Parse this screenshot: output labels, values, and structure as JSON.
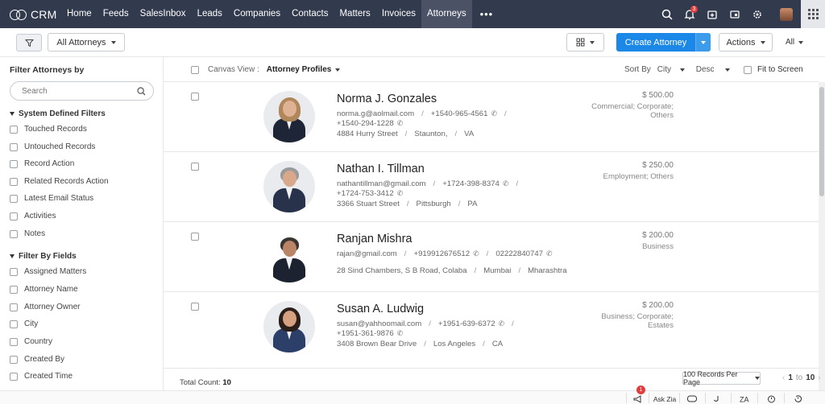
{
  "brand": {
    "name": "CRM",
    "icon": "crm-logo-icon"
  },
  "nav": {
    "items": [
      "Home",
      "Feeds",
      "SalesInbox",
      "Leads",
      "Companies",
      "Contacts",
      "Matters",
      "Invoices",
      "Attorneys"
    ],
    "active": "Attorneys",
    "more": "•••",
    "notification_count": "3"
  },
  "toolbar": {
    "view_filter": "All Attorneys",
    "create_label": "Create Attorney",
    "actions_label": "Actions",
    "all_label": "All"
  },
  "sidebar": {
    "title": "Filter Attorneys by",
    "search_placeholder": "Search",
    "system_section": "System Defined Filters",
    "system_filters": [
      "Touched Records",
      "Untouched Records",
      "Record Action",
      "Related Records Action",
      "Latest Email Status",
      "Activities",
      "Notes"
    ],
    "fields_section": "Filter By Fields",
    "field_filters": [
      "Assigned Matters",
      "Attorney Name",
      "Attorney Owner",
      "City",
      "Country",
      "Created By",
      "Created Time"
    ]
  },
  "canvas": {
    "label": "Canvas View :",
    "value": "Attorney Profiles",
    "sort_label": "Sort By",
    "sort_field": "City",
    "sort_order": "Desc",
    "fit_label": "Fit to Screen"
  },
  "records": [
    {
      "name": "Norma J. Gonzales",
      "line1": [
        "norma.g@aolmail.com",
        "+1540-965-4561"
      ],
      "line2": [
        "+1540-294-1228"
      ],
      "line3": [
        "4884 Hurry Street",
        "Staunton,",
        "VA"
      ],
      "amount": "$ 500.00",
      "categories": "Commercial; Corporate; Others"
    },
    {
      "name": "Nathan I. Tillman",
      "line1": [
        "nathantillman@gmail.com",
        "+1724-398-8374"
      ],
      "line2": [
        "+1724-753-3412"
      ],
      "line3": [
        "3366 Stuart Street",
        "Pittsburgh",
        "PA"
      ],
      "amount": "$ 250.00",
      "categories": "Employment; Others"
    },
    {
      "name": "Ranjan Mishra",
      "line1": [
        "rajan@gmail.com",
        "+919912676512",
        "02222840747"
      ],
      "line2": [],
      "line3": [
        "28 Sind Chambers, S B Road, Colaba",
        "Mumbai",
        "Mharashtra"
      ],
      "amount": "$ 200.00",
      "categories": "Business"
    },
    {
      "name": "Susan A. Ludwig",
      "line1": [
        "susan@yahhoomail.com",
        "+1951-639-6372"
      ],
      "line2": [
        "+1951-361-9876"
      ],
      "line3": [
        "3408 Brown Bear Drive",
        "Los Angeles",
        "CA"
      ],
      "amount": "$ 200.00",
      "categories": "Business; Corporate; Estates"
    }
  ],
  "footer": {
    "total_label": "Total Count:",
    "total_value": "10",
    "per_page": "100 Records Per Page",
    "page_from": "1",
    "page_to_word": "to",
    "page_to": "10"
  },
  "bottom": {
    "ask_zia": "Ask Zia",
    "badge": "1"
  }
}
